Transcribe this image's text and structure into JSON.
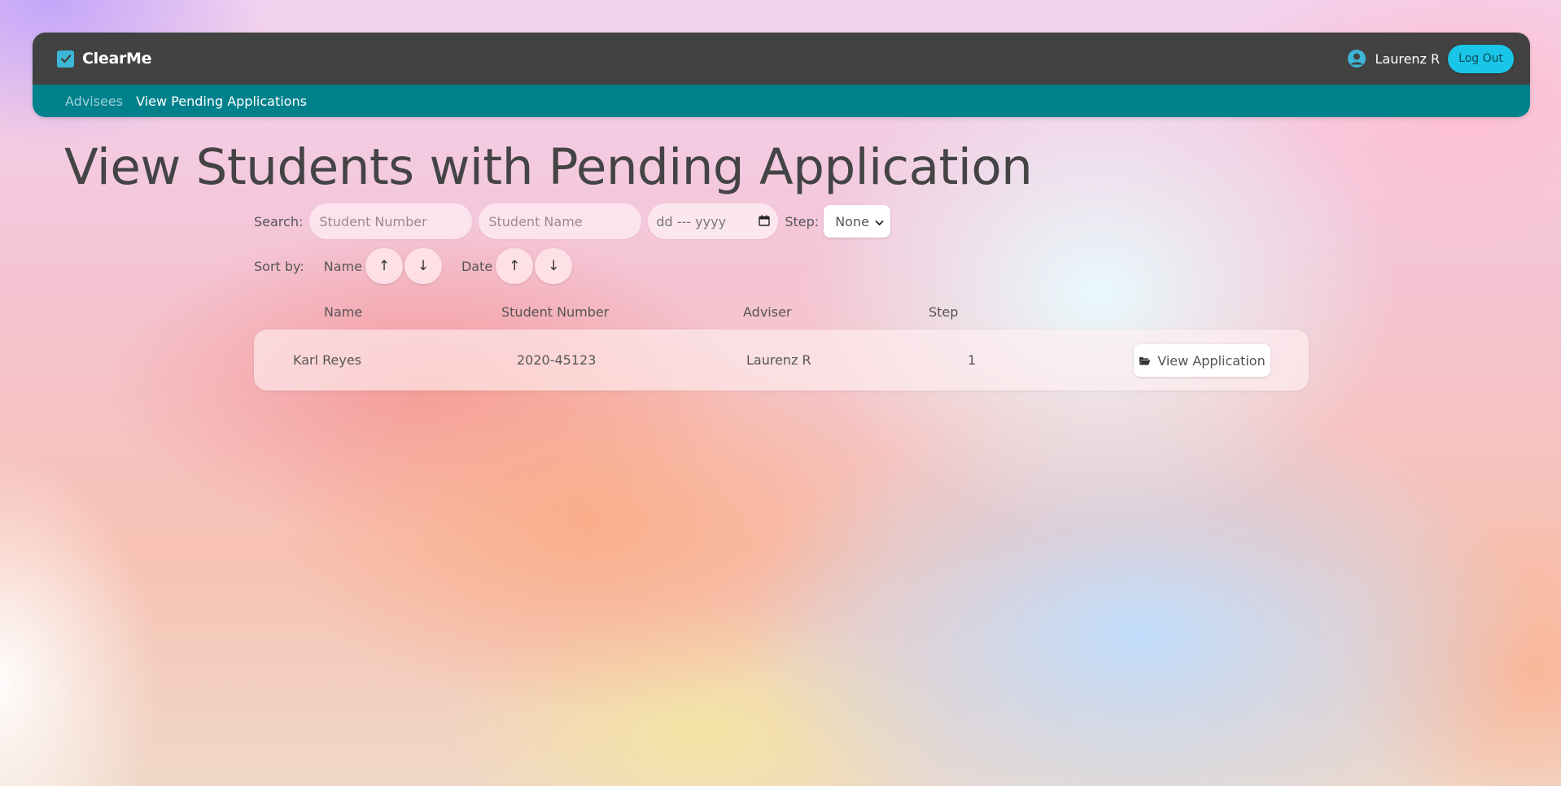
{
  "app": {
    "name": "ClearMe"
  },
  "user": {
    "name": "Laurenz R",
    "logout_label": "Log Out"
  },
  "nav": {
    "links": [
      {
        "label": "Advisees",
        "active": false
      },
      {
        "label": "View Pending Applications",
        "active": true
      }
    ]
  },
  "page": {
    "title": "View Students with Pending Application"
  },
  "search": {
    "label": "Search:",
    "student_number_placeholder": "Student Number",
    "student_name_placeholder": "Student Name",
    "date_placeholder": "dd --- yyyy",
    "step_label": "Step:",
    "step_selected": "None"
  },
  "sort": {
    "label": "Sort by:",
    "name_label": "Name",
    "date_label": "Date",
    "asc_symbol": "↑",
    "desc_symbol": "↓"
  },
  "table": {
    "headers": [
      "Name",
      "Student Number",
      "Adviser",
      "Step"
    ],
    "rows": [
      {
        "name": "Karl Reyes",
        "student_number": "2020-45123",
        "adviser": "Laurenz R",
        "step": "1",
        "action_label": "View Application"
      }
    ]
  },
  "colors": {
    "navbar_dark": "#424242",
    "navbar_teal": "#00818c",
    "logout_button": "#19c6e8",
    "brand_check": "#3cb6d6"
  },
  "icons": {
    "brand": "checkbox-checked-icon",
    "user": "user-circle-icon",
    "calendar": "calendar-icon",
    "select": "chevron-down-icon",
    "view": "folder-open-icon"
  }
}
